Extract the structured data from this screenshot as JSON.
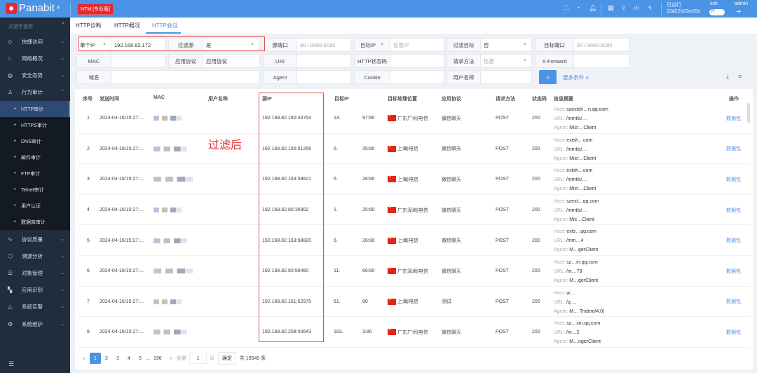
{
  "header": {
    "logo": "Panabit",
    "edition": "NTM [专业版]",
    "uptime_label": "已运行",
    "uptime": "12d22h22m25s",
    "ssh_label": "ssh",
    "ssh_toggle": "开",
    "user": "admin",
    "icons": [
      "fullscreen-icon",
      "dashboard-icon",
      "bell-icon",
      "qrcode-icon",
      "upload-icon",
      "code-icon",
      "flash-icon"
    ]
  },
  "sidebar": {
    "search_placeholder": "关键字搜索",
    "top_items": [
      {
        "label": "快捷访问",
        "icon": "diamond-icon"
      },
      {
        "label": "网络概况",
        "icon": "home-icon"
      },
      {
        "label": "安全态势",
        "icon": "globe-icon"
      },
      {
        "label": "行为审计",
        "icon": "user-audit-icon"
      }
    ],
    "sub_items": [
      "HTTP审计",
      "HTTPS审计",
      "DNS审计",
      "邮件审计",
      "FTP审计",
      "Telnet审计",
      "用户认证",
      "数据库审计"
    ],
    "bottom_items": [
      {
        "label": "协议质量",
        "icon": "pulse-icon"
      },
      {
        "label": "溯源分析",
        "icon": "trace-icon"
      },
      {
        "label": "对象管理",
        "icon": "database-icon"
      },
      {
        "label": "应用识别",
        "icon": "apps-icon"
      },
      {
        "label": "系统告警",
        "icon": "bell-icon"
      },
      {
        "label": "系统维护",
        "icon": "gear-icon"
      }
    ]
  },
  "tabs": [
    "HTTP诊断",
    "HTTP概况",
    "HTTP会话"
  ],
  "filters": {
    "ip_type": "单个IP",
    "ip_value": "192.168.82.172",
    "filter_src_label": "过滤源",
    "filter_src_value": "是",
    "src_port_label": "源端口",
    "src_port_ph": "80 / 8000-8080",
    "dst_ip_label": "目标IP",
    "dst_ip_ph": "任意IP",
    "filter_dst_label": "过滤目标",
    "filter_dst_value": "否",
    "dst_port_label": "目标端口",
    "dst_port_ph": "80 / 8000-8080",
    "mac_label": "MAC",
    "app_label": "应用协议",
    "app_value": "应用协议",
    "uri_label": "URI",
    "status_label": "HTTP状态码",
    "method_label": "请求方法",
    "method_value": "任意",
    "xfwd_label": "X-Forward",
    "domain_label": "域名",
    "agent_label": "Agent",
    "cookie_label": "Cookie",
    "username_label": "用户名称",
    "more": "更多条件 ∧"
  },
  "table": {
    "headers": [
      "序号",
      "发送时间",
      "MAC",
      "用户名称",
      "源IP",
      "目标IP",
      "目标地理位置",
      "应用协议",
      "请求方法",
      "状态码",
      "信息摘要",
      "操作"
    ],
    "summary_keys": [
      "Host:",
      "URL:",
      "Agent:"
    ],
    "rows": [
      {
        "no": "1",
        "time": "2024-04-16/15:27:...",
        "src": "192.168.82.180:43764",
        "dst_a": "14.",
        "dst_b": "97:80",
        "geo": "广东广州|电信",
        "app": "微信聊天",
        "method": "POST",
        "code": "200",
        "host": "szextsh…n.qq.com",
        "url": "/mmtls/…",
        "agent": "Micr…Client",
        "op": "数据包"
      },
      {
        "no": "2",
        "time": "2024-04-16/15:27:...",
        "src": "192.168.82.155:51266",
        "dst_a": "6.",
        "dst_b": "35:80",
        "geo": "上海|电信",
        "app": "微信聊天",
        "method": "POST",
        "code": "200",
        "host": "extsh…com",
        "url": "/mmtls/…",
        "agent": "Micr…Client",
        "op": "数据包"
      },
      {
        "no": "3",
        "time": "2024-04-16/15:27:...",
        "src": "192.168.82.163:58821",
        "dst_a": "6.",
        "dst_b": "26:80",
        "geo": "上海|电信",
        "app": "微信聊天",
        "method": "POST",
        "code": "200",
        "host": "extsh…com",
        "url": "/mmtls/…",
        "agent": "Micr…Client",
        "op": "数据包"
      },
      {
        "no": "4",
        "time": "2024-04-16/15:27:...",
        "src": "192.168.82.80:36902",
        "dst_a": "1.",
        "dst_b": "25:80",
        "geo": "广东深圳|电信",
        "app": "微信聊天",
        "method": "POST",
        "code": "200",
        "host": "szext…qq.com",
        "url": "/mmtls/…",
        "agent": "Mic…Client",
        "op": "数据包"
      },
      {
        "no": "5",
        "time": "2024-04-16/15:27:...",
        "src": "192.168.82.163:58820",
        "dst_a": "6.",
        "dst_b": "26:80",
        "geo": "上海|电信",
        "app": "微信聊天",
        "method": "POST",
        "code": "200",
        "host": "exts…qq.com",
        "url": "/mm…4",
        "agent": "M…gerClient",
        "op": "数据包"
      },
      {
        "no": "6",
        "time": "2024-04-16/15:27:...",
        "src": "192.168.82.80:56480",
        "dst_a": "11.",
        "dst_b": "66:80",
        "geo": "广东深圳|电信",
        "app": "微信聊天",
        "method": "POST",
        "code": "200",
        "host": "sz…in.qq.com",
        "url": "/m…78",
        "agent": "M…gerClient",
        "op": "数据包"
      },
      {
        "no": "7",
        "time": "2024-04-16/15:27:...",
        "src": "192.168.82.161:52975",
        "dst_a": "61.",
        "dst_b": "80",
        "geo": "上海|电信",
        "app": "测试",
        "method": "POST",
        "code": "200",
        "host": "w…",
        "url": "/q.…",
        "agent": "M… Trident/4.0)",
        "op": "数据包"
      },
      {
        "no": "8",
        "time": "2024-04-16/15:27:...",
        "src": "192.168.82.208:50643",
        "dst_a": "183.",
        "dst_b": "3:80",
        "geo": "广东广州|电信",
        "app": "微信聊天",
        "method": "POST",
        "code": "200",
        "host": "sz…xin.qq.com",
        "url": "/m…2",
        "agent": "M…ngerClient",
        "op": "数据包"
      }
    ]
  },
  "annotation": "过滤后",
  "pagination": {
    "pages": [
      "1",
      "2",
      "3",
      "4",
      "5"
    ],
    "ellipsis": "...",
    "last": "196",
    "goto_label": "到第",
    "goto_value": "1",
    "page_unit": "页",
    "confirm": "确定",
    "total": "共 19545 条"
  },
  "colors": {
    "header": "#4a93e6",
    "sidebar": "#1f2d3d",
    "highlight": "#e84a4a"
  }
}
